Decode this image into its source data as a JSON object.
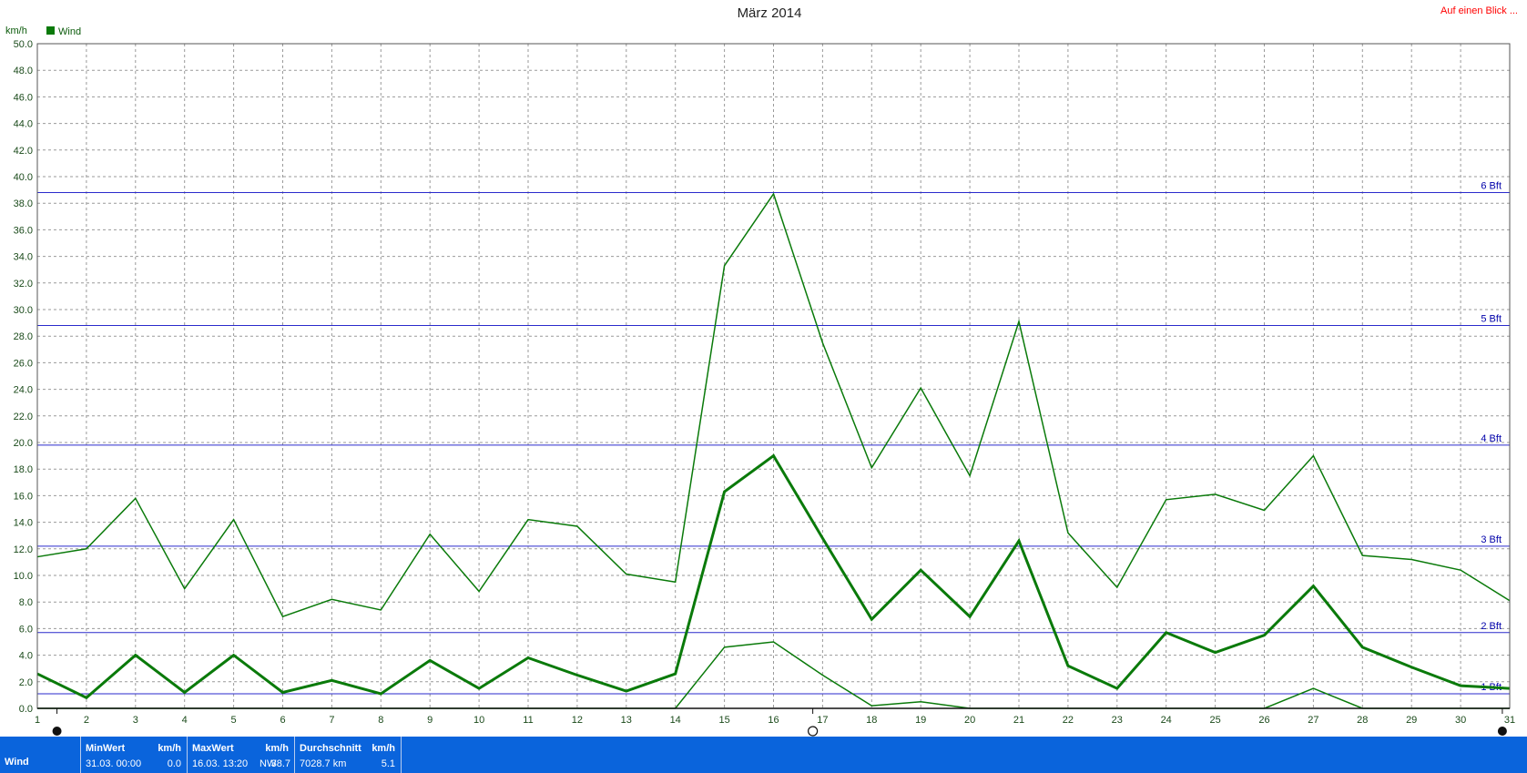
{
  "header": {
    "title": "März 2014",
    "link": "Auf einen Blick ...",
    "unit": "km/h",
    "legend": "Wind"
  },
  "colors": {
    "series": "#0a7a0a",
    "bft_line": "#2a2acc",
    "grid": "#9a9a9a",
    "status_bar": "#0a64dc",
    "link": "#ff0000"
  },
  "chart_data": {
    "type": "line",
    "title": "März 2014",
    "ylabel": "km/h",
    "xlim": [
      1,
      31
    ],
    "ylim": [
      0,
      50
    ],
    "y_ticks": [
      "0.0",
      "2.0",
      "4.0",
      "6.0",
      "8.0",
      "10.0",
      "12.0",
      "14.0",
      "16.0",
      "18.0",
      "20.0",
      "22.0",
      "24.0",
      "26.0",
      "28.0",
      "30.0",
      "32.0",
      "34.0",
      "36.0",
      "38.0",
      "40.0",
      "42.0",
      "44.0",
      "46.0",
      "48.0",
      "50.0"
    ],
    "x": [
      1,
      2,
      3,
      4,
      5,
      6,
      7,
      8,
      9,
      10,
      11,
      12,
      13,
      14,
      15,
      16,
      17,
      18,
      19,
      20,
      21,
      22,
      23,
      24,
      25,
      26,
      27,
      28,
      29,
      30,
      31
    ],
    "legend": "top-left",
    "grid": true,
    "series": [
      {
        "name": "Wind",
        "role": "max",
        "width": 1.5,
        "values": [
          11.4,
          12.0,
          15.8,
          9.0,
          14.2,
          6.9,
          8.2,
          7.4,
          13.1,
          8.8,
          14.2,
          13.7,
          10.1,
          9.5,
          33.3,
          38.7,
          27.5,
          18.1,
          24.1,
          17.5,
          29.1,
          13.2,
          9.1,
          15.7,
          16.1,
          14.9,
          19.0,
          11.5,
          11.2,
          10.4,
          8.1
        ]
      },
      {
        "name": "",
        "role": "avg",
        "width": 3,
        "values": [
          2.6,
          0.8,
          4.0,
          1.2,
          4.0,
          1.2,
          2.1,
          1.1,
          3.6,
          1.5,
          3.8,
          2.5,
          1.3,
          2.6,
          16.3,
          19.0,
          12.8,
          6.7,
          10.4,
          6.9,
          12.6,
          3.2,
          1.5,
          5.7,
          4.2,
          5.5,
          9.2,
          4.6,
          3.1,
          1.7,
          1.5
        ]
      },
      {
        "name": "",
        "role": "min",
        "width": 1.5,
        "values": [
          0,
          0,
          0,
          0,
          0,
          0,
          0,
          0,
          0,
          0,
          0,
          0,
          0,
          0,
          4.6,
          5.0,
          2.5,
          0.2,
          0.5,
          0,
          0,
          0,
          0,
          0,
          0,
          0,
          1.5,
          0,
          0,
          0,
          0
        ]
      }
    ],
    "reference_lines": [
      {
        "label": "1 Bft",
        "value": 1.1
      },
      {
        "label": "2 Bft",
        "value": 5.7
      },
      {
        "label": "3 Bft",
        "value": 12.2
      },
      {
        "label": "4 Bft",
        "value": 19.8
      },
      {
        "label": "5 Bft",
        "value": 28.8
      },
      {
        "label": "6 Bft",
        "value": 38.8
      }
    ]
  },
  "status": {
    "series_name": "Wind",
    "min": {
      "head": "MinWert",
      "unit": "km/h",
      "time": "31.03.  00:00",
      "value": "0.0"
    },
    "max": {
      "head": "MaxWert",
      "unit": "km/h",
      "time": "16.03.  13:20",
      "dir": "NW",
      "value": "38.7"
    },
    "avg": {
      "head": "Durchschnitt",
      "unit": "km/h",
      "extra": "7028.7 km",
      "value": "5.1"
    }
  }
}
